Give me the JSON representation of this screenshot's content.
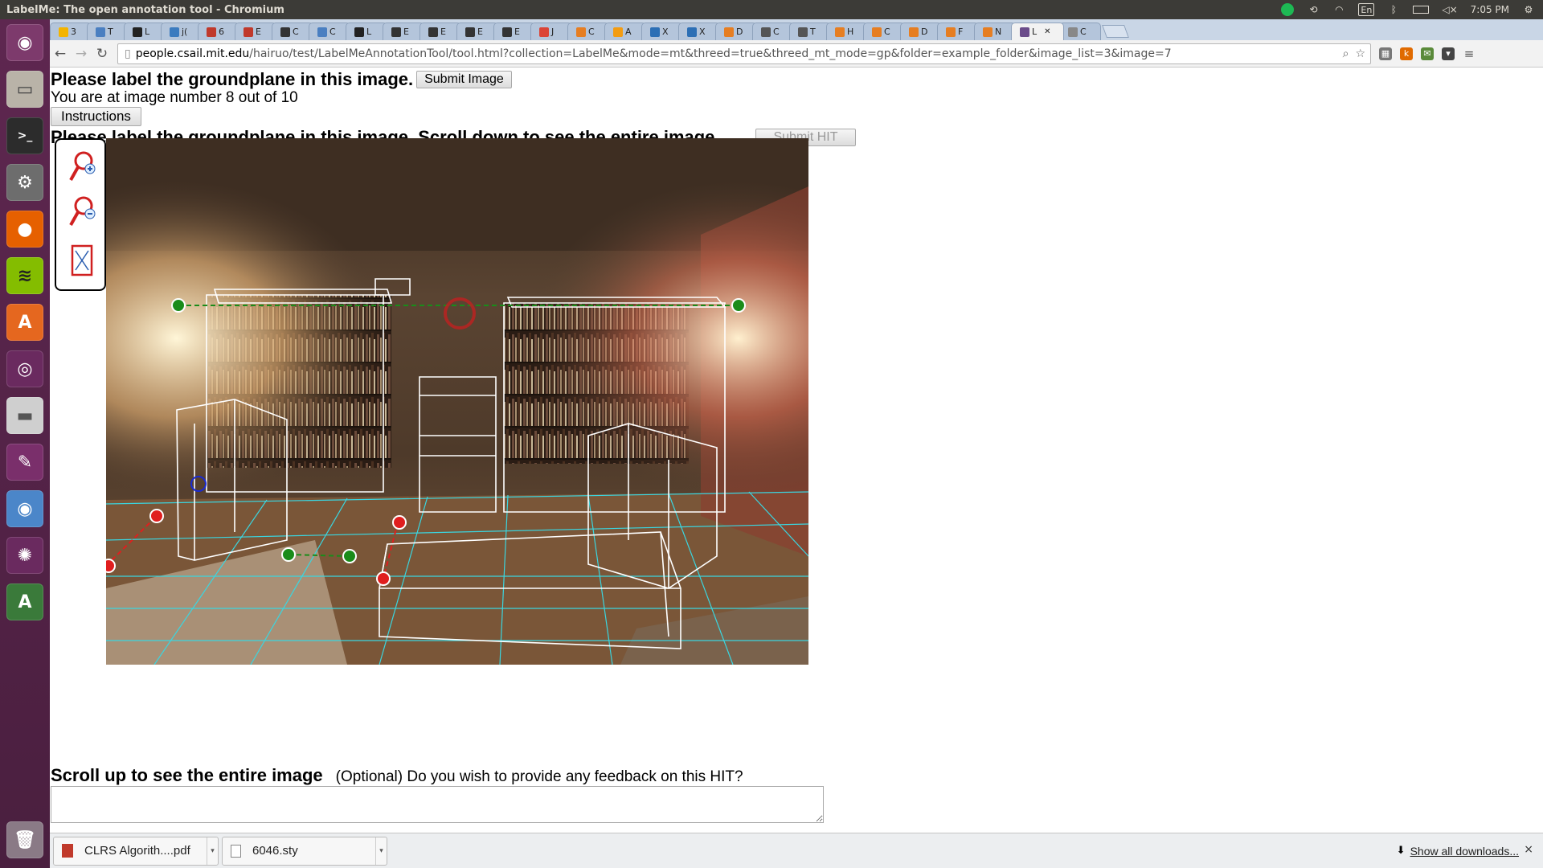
{
  "window": {
    "title": "LabelMe: The open annotation tool - Chromium"
  },
  "panel": {
    "keyboard": "En",
    "clock": "7:05 PM"
  },
  "tabs": [
    {
      "label": "3",
      "color": "#f4b400"
    },
    {
      "label": "T",
      "color": "#4a7fc1"
    },
    {
      "label": "L",
      "color": "#222222"
    },
    {
      "label": "j(",
      "color": "#3b7bbf"
    },
    {
      "label": "6",
      "color": "#c0392b"
    },
    {
      "label": "E",
      "color": "#c0392b"
    },
    {
      "label": "C",
      "color": "#333333"
    },
    {
      "label": "C",
      "color": "#4a7fc1"
    },
    {
      "label": "L",
      "color": "#222222"
    },
    {
      "label": "E",
      "color": "#333333"
    },
    {
      "label": "E",
      "color": "#333333"
    },
    {
      "label": "E",
      "color": "#333333"
    },
    {
      "label": "E",
      "color": "#333333"
    },
    {
      "label": "J",
      "color": "#db4437"
    },
    {
      "label": "C",
      "color": "#e67e22"
    },
    {
      "label": "A",
      "color": "#f39c12"
    },
    {
      "label": "X",
      "color": "#2c6fb5"
    },
    {
      "label": "X",
      "color": "#2c6fb5"
    },
    {
      "label": "D",
      "color": "#e67e22"
    },
    {
      "label": "C",
      "color": "#555555"
    },
    {
      "label": "T",
      "color": "#555555"
    },
    {
      "label": "H",
      "color": "#e67e22"
    },
    {
      "label": "C",
      "color": "#e67e22"
    },
    {
      "label": "D",
      "color": "#e67e22"
    },
    {
      "label": "F",
      "color": "#e67e22"
    },
    {
      "label": "N",
      "color": "#e67e22"
    },
    {
      "label": "L",
      "color": "#6b4c8a"
    },
    {
      "label": "C",
      "color": "#888888"
    }
  ],
  "active_tab_index": 26,
  "active_tab_close": "✕",
  "url": {
    "host": "people.csail.mit.edu",
    "path": "/hairuo/test/LabelMeAnnotationTool/tool.html?collection=LabelMe&mode=mt&threed=true&threed_mt_mode=gp&folder=example_folder&image_list=3&image=7"
  },
  "page": {
    "heading": "Please label the groundplane in this image.",
    "submit_image_label": "Submit Image",
    "progress_text": "You are at image number 8 out of 10",
    "instructions_label": "Instructions",
    "heading2": "Please label the groundplane in this image. Scroll down to see the entire image",
    "submit_hit_label": "Submit HIT",
    "scroll_up_text": "Scroll up to see the entire image",
    "feedback_prompt": "(Optional) Do you wish to provide any feedback on this HIT?",
    "feedback_value": ""
  },
  "downloads": {
    "items": [
      {
        "name": "CLRS Algorith....pdf",
        "icon_color": "#c0392b"
      },
      {
        "name": "6046.sty",
        "icon_color": "#888888"
      }
    ],
    "show_all_label": "Show all downloads...",
    "close_glyph": "×"
  },
  "colors": {
    "panel": "#3c3b37",
    "launcher": "#5e2750",
    "groundplane_grid": "#3ad6e0",
    "point_green": "#1a8c1a",
    "point_red": "#e01e1e",
    "box_lines": "#ffffff"
  }
}
